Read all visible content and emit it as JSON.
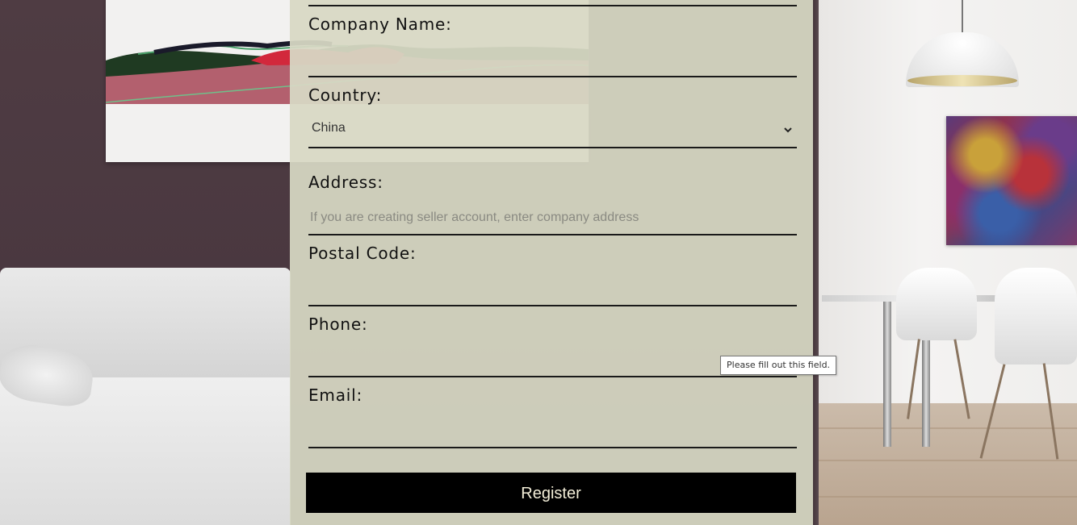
{
  "form": {
    "company_name": {
      "label": "Company Name:",
      "value": "",
      "placeholder": ""
    },
    "country": {
      "label": "Country:",
      "selected": "China"
    },
    "address": {
      "label": "Address:",
      "value": "",
      "placeholder": "If you are creating seller account, enter company address"
    },
    "postal_code": {
      "label": "Postal Code:",
      "value": "",
      "placeholder": ""
    },
    "phone": {
      "label": "Phone:",
      "value": "",
      "placeholder": ""
    },
    "email": {
      "label": "Email:",
      "value": "",
      "placeholder": ""
    },
    "submit_label": "Register"
  },
  "validation_tooltip": "Please fill out this field.",
  "colors": {
    "panel_bg": "#d7d8c4",
    "button_bg": "#000000",
    "button_text": "#f3eed8",
    "rule": "#1a1a1a"
  },
  "icons": {
    "select_arrow": "chevron-down-icon"
  }
}
